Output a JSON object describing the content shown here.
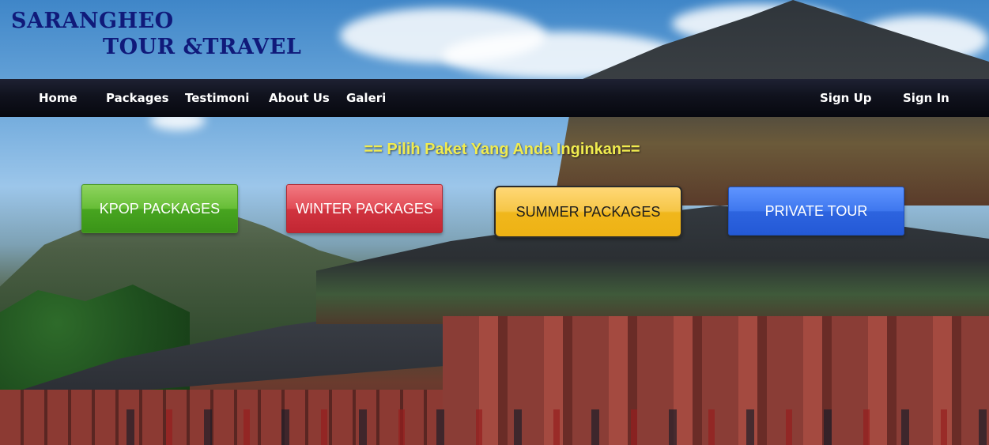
{
  "header": {
    "brand_line1": "SARANGHEO",
    "brand_line2": "TOUR &TRAVEL"
  },
  "nav": {
    "left": [
      "Home",
      "Packages",
      "Testimoni",
      "About Us",
      "Galeri"
    ],
    "right": [
      "Sign Up",
      "Sign In"
    ]
  },
  "main": {
    "headline": "== Pilih Paket Yang Anda Inginkan==",
    "packages": [
      {
        "label": "KPOP PACKAGES",
        "color": "#5cb82f"
      },
      {
        "label": "WINTER PACKAGES",
        "color": "#d9414b"
      },
      {
        "label": "SUMMER PACKAGES",
        "color": "#f2bd2c"
      },
      {
        "label": "PRIVATE TOUR",
        "color": "#356ee6"
      }
    ]
  },
  "colors": {
    "brand_text": "#101a7a",
    "nav_background": "#10121d",
    "headline_text": "#f1ec4f"
  }
}
